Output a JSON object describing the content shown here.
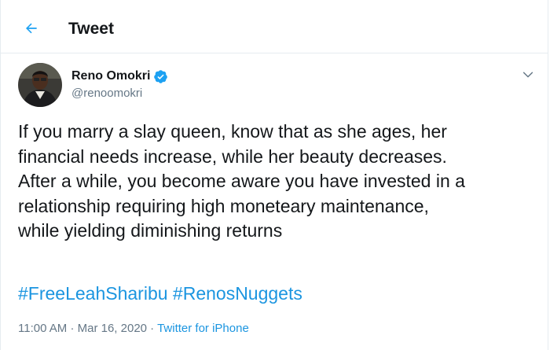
{
  "header": {
    "title": "Tweet",
    "back_icon": "arrow-left-icon",
    "accent_color": "#1da1f2"
  },
  "tweet": {
    "author": {
      "display_name": "Reno Omokri",
      "handle": "@renoomokri",
      "verified": true,
      "verified_icon": "verified-badge-icon"
    },
    "more_icon": "chevron-down-icon",
    "text_lines": [
      "If you marry a slay queen, know that as she ages, her",
      "financial needs increase, while her beauty decreases.",
      "After a while, you become aware you have invested in a",
      "relationship requiring high moneteary maintenance,",
      "while yielding diminishing returns"
    ],
    "hashtags": [
      "#FreeLeahSharibu",
      "#RenosNuggets"
    ],
    "time": "11:00 AM",
    "date": "Mar 16, 2020",
    "separator": "·",
    "source": "Twitter for iPhone"
  },
  "colors": {
    "link": "#1b95e0",
    "muted": "#657786",
    "text": "#14171a",
    "border": "#e6ecf0"
  }
}
